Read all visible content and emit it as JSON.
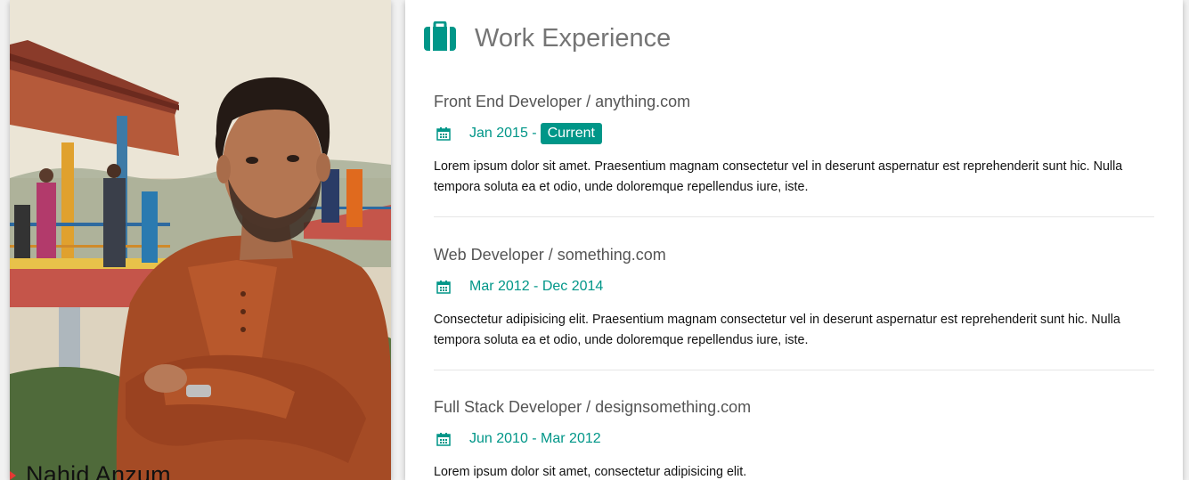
{
  "profile": {
    "name": "Nahid Anzum"
  },
  "section": {
    "title": "Work Experience",
    "icon": "briefcase-icon",
    "accent_color": "#009688"
  },
  "jobs": [
    {
      "role": "Front End Developer / anything.com",
      "date": "Jan 2015 - ",
      "badge": "Current",
      "description": "Lorem ipsum dolor sit amet. Praesentium magnam consectetur vel in deserunt aspernatur est reprehenderit sunt hic. Nulla tempora soluta ea et odio, unde doloremque repellendus iure, iste."
    },
    {
      "role": "Web Developer / something.com",
      "date": "Mar 2012 - Dec 2014",
      "description": "Consectetur adipisicing elit. Praesentium magnam consectetur vel in deserunt aspernatur est reprehenderit sunt hic. Nulla tempora soluta ea et odio, unde doloremque repellendus iure, iste."
    },
    {
      "role": "Full Stack Developer / designsomething.com",
      "date": "Jun 2010 - Mar 2012",
      "description": "Lorem ipsum dolor sit amet, consectetur adipisicing elit."
    }
  ]
}
